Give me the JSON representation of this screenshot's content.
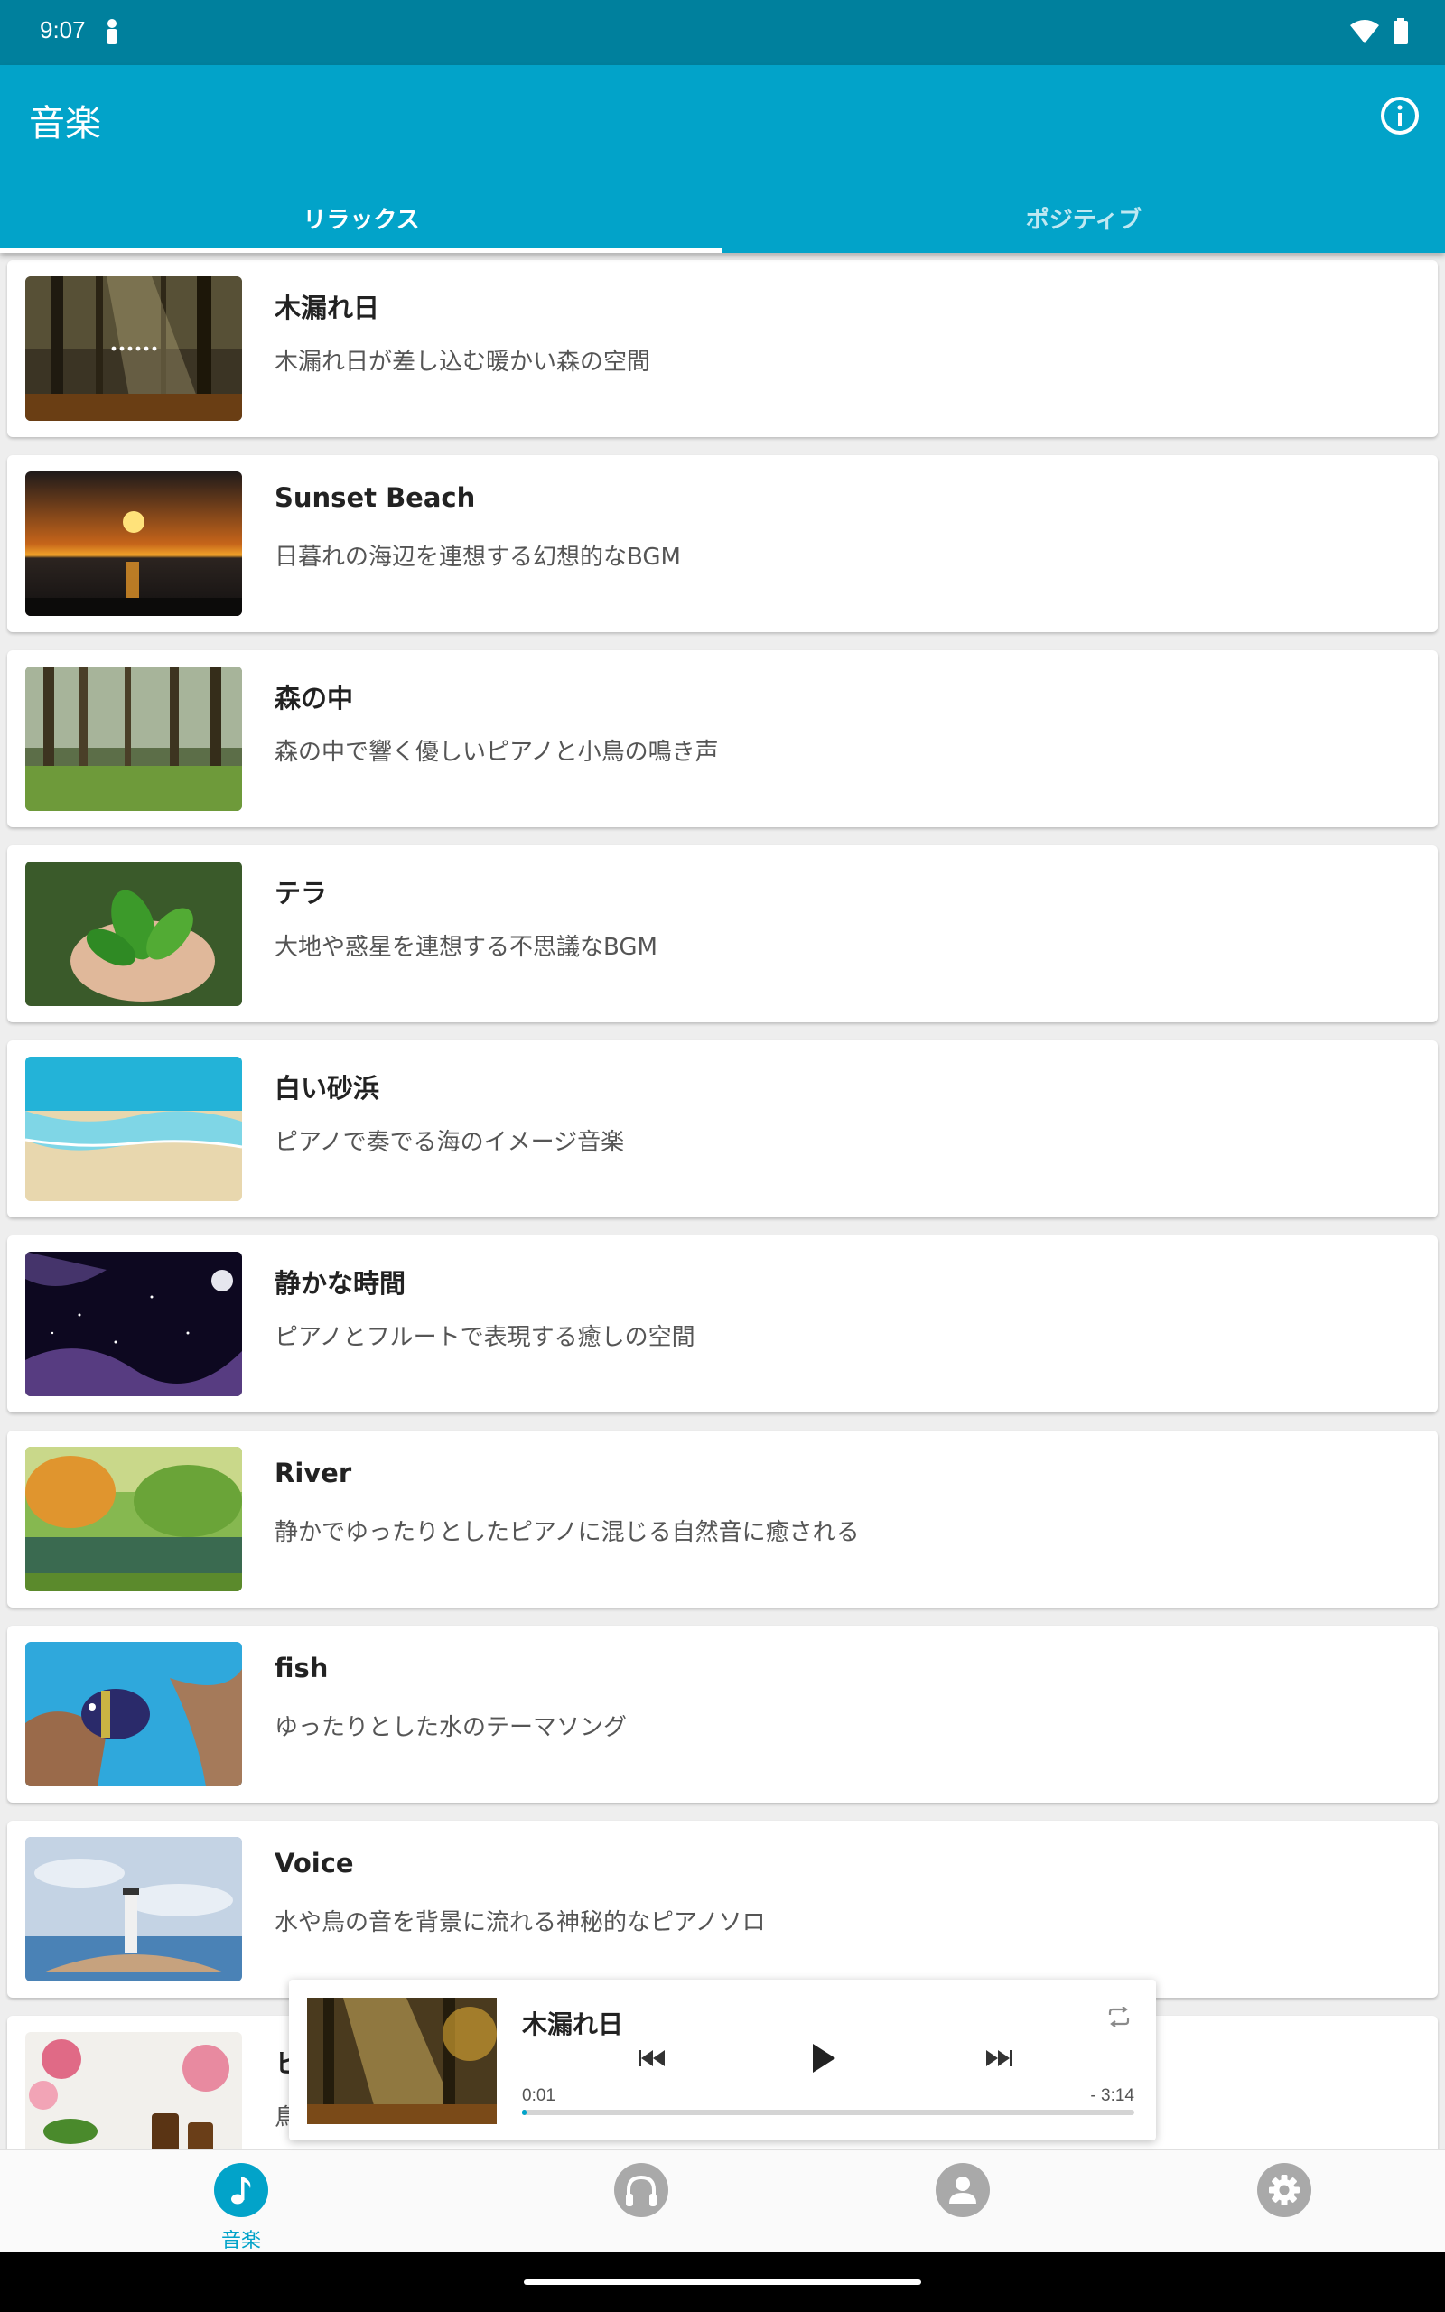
{
  "status_bar": {
    "time": "9:07"
  },
  "app_bar": {
    "title": "音楽"
  },
  "tabs": [
    {
      "label": "リラックス",
      "active": true
    },
    {
      "label": "ポジティブ",
      "active": false
    }
  ],
  "tracks": [
    {
      "title": "木漏れ日",
      "description": "木漏れ日が差し込む暖かい森の空間",
      "thumb": "forest-sunlight"
    },
    {
      "title": "Sunset Beach",
      "description": "日暮れの海辺を連想する幻想的なBGM",
      "thumb": "sunset"
    },
    {
      "title": "森の中",
      "description": "森の中で響く優しいピアノと小鳥の鳴き声",
      "thumb": "forest"
    },
    {
      "title": "テラ",
      "description": "大地や惑星を連想する不思議なBGM",
      "thumb": "leaves"
    },
    {
      "title": "白い砂浜",
      "description": "ピアノで奏でる海のイメージ音楽",
      "thumb": "beach"
    },
    {
      "title": "静かな時間",
      "description": "ピアノとフルートで表現する癒しの空間",
      "thumb": "night-sky"
    },
    {
      "title": "River",
      "description": "静かでゆったりとしたピアノに混じる自然音に癒される",
      "thumb": "river"
    },
    {
      "title": "fish",
      "description": "ゆったりとした水のテーマソング",
      "thumb": "fish"
    },
    {
      "title": "Voice",
      "description": "水や鳥の音を背景に流れる神秘的なピアノソロ",
      "thumb": "lighthouse"
    },
    {
      "title": "ヒ",
      "description": "鳥",
      "thumb": "flowers"
    }
  ],
  "player": {
    "title": "木漏れ日",
    "current_time": "0:01",
    "remaining_time": "- 3:14",
    "progress": 0.005
  },
  "bottom_nav": [
    {
      "label": "音楽",
      "icon": "music-note-icon",
      "active": true
    },
    {
      "label": "",
      "icon": "headphones-icon",
      "active": false
    },
    {
      "label": "",
      "icon": "account-icon",
      "active": false
    },
    {
      "label": "",
      "icon": "gear-icon",
      "active": false
    }
  ],
  "colors": {
    "primary": "#02a3c9",
    "status_bar": "#00809d",
    "inactive_icon": "#a9a9a9"
  }
}
